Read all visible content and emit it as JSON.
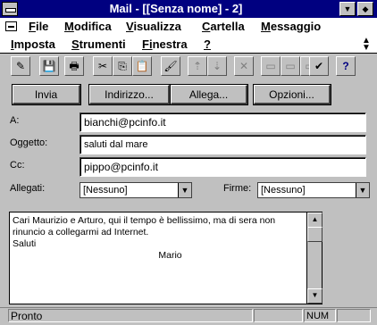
{
  "window": {
    "title": "Mail - [[Senza nome] - 2]"
  },
  "titlebar_buttons": {
    "minimize": "▼",
    "maximize": "◆"
  },
  "menu": {
    "row1": [
      {
        "first": "F",
        "rest": "ile"
      },
      {
        "first": "M",
        "rest": "odifica"
      },
      {
        "first": "V",
        "rest": "isualizza"
      },
      {
        "first": "C",
        "rest": "artella"
      },
      {
        "first": "M",
        "rest": "essaggio"
      }
    ],
    "row2": [
      {
        "first": "I",
        "rest": "mposta"
      },
      {
        "first": "S",
        "rest": "trumenti"
      },
      {
        "first": "Fi",
        "rest": "nestra"
      },
      {
        "first": "?",
        "rest": ""
      }
    ],
    "scroll": "▲\n▼"
  },
  "toolbar": {
    "icons": [
      "✎",
      "💾",
      "🖶",
      "✂",
      "⎘",
      "📋",
      "🖌",
      "⇡",
      "⇣",
      "✕",
      "▭",
      "▭",
      "▭",
      "✔",
      "?"
    ]
  },
  "buttons": {
    "send": "Invia",
    "address": "Indirizzo...",
    "attach": "Allega...",
    "options": "Opzioni..."
  },
  "form": {
    "to_label": "A:",
    "to_value": "bianchi@pcinfo.it",
    "subject_label": "Oggetto:",
    "subject_value": "saluti dal mare",
    "cc_label": "Cc:",
    "cc_value": "pippo@pcinfo.it",
    "attachments_label": "Allegati:",
    "attachments_value": "[Nessuno]",
    "signature_label": "Firme:",
    "signature_value": "[Nessuno]"
  },
  "message": {
    "body": "Cari Maurizio e Arturo, qui il tempo è bellissimo, ma di sera non rinuncio a collegarmi ad Internet.\nSaluti\n                                                        Mario"
  },
  "status": {
    "text": "Pronto",
    "num": "NUM"
  }
}
